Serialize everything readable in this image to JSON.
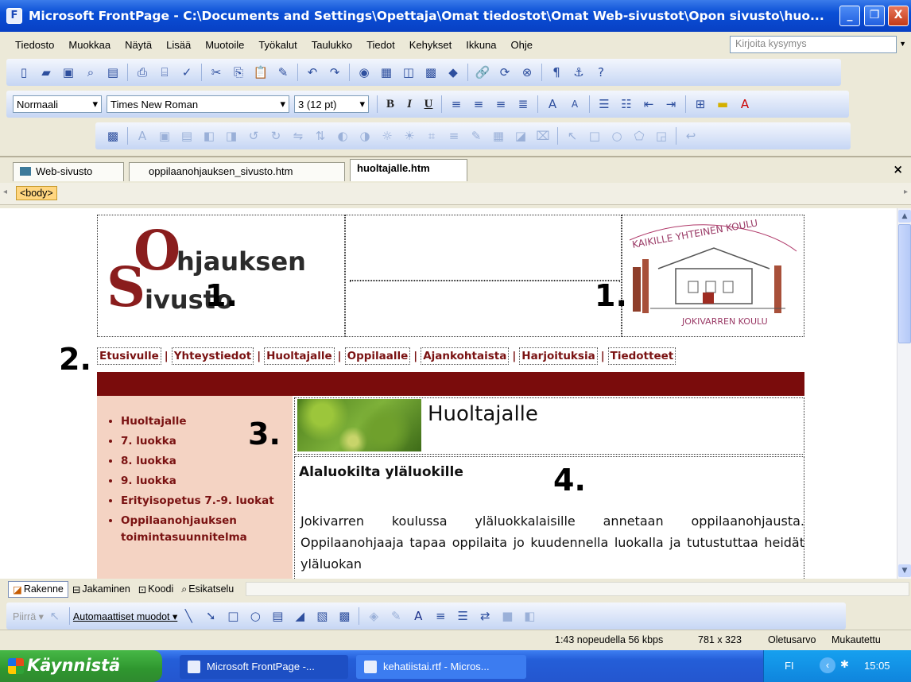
{
  "window": {
    "title": "Microsoft FrontPage - C:\\Documents and Settings\\Opettaja\\Omat tiedostot\\Omat Web-sivustot\\Opon sivusto\\huo...",
    "minimize": "_",
    "maximize": "❐",
    "close": "X"
  },
  "menu": {
    "items": [
      "Tiedosto",
      "Muokkaa",
      "Näytä",
      "Lisää",
      "Muotoile",
      "Työkalut",
      "Taulukko",
      "Tiedot",
      "Kehykset",
      "Ikkuna",
      "Ohje"
    ],
    "ask_placeholder": "Kirjoita kysymys"
  },
  "formatting": {
    "style": "Normaali",
    "font": "Times New Roman",
    "size": "3 (12 pt)",
    "bold": "B",
    "italic": "I",
    "underline": "U"
  },
  "doc_tabs": [
    "Web-sivusto",
    "oppilaanohjauksen_sivusto.htm",
    "huoltajalle.htm"
  ],
  "tab_close": "×",
  "quick_tag": "<body>",
  "page": {
    "logo_o": "O",
    "logo_s": "S",
    "logo_line1": "hjauksen",
    "logo_line2": "ivusto",
    "school_top": "KAIKILLE YHTEINEN KOULU",
    "school_bottom": "JOKIVARREN KOULU",
    "annotations": [
      "1.",
      "1.",
      "2.",
      "3.",
      "4."
    ],
    "nav": [
      "Etusivulle",
      "Yhteystiedot",
      "Huoltajalle",
      "Oppilaalle",
      "Ajankohtaista",
      "Harjoituksia",
      "Tiedotteet"
    ],
    "nav_sep": "|",
    "sidebar": [
      "Huoltajalle",
      "7. luokka",
      "8. luokka",
      "9. luokka",
      "Erityisopetus 7.-9. luokat",
      "Oppilaanohjauksen toimintasuunnitelma"
    ],
    "heading": "Huoltajalle",
    "subheading": "Alaluokilta yläluokille",
    "paragraph": "Jokivarren koulussa yläluokkalaisille annetaan oppilaanohjausta. Oppilaanohjaaja tapaa oppilaita jo kuudennella luokalla ja tutustuttaa heidät yläluokan"
  },
  "view_tabs": [
    "Rakenne",
    "Jakaminen",
    "Koodi",
    "Esikatselu"
  ],
  "drawing": {
    "draw": "Piirrä",
    "autoshapes": "Automaattiset muodot"
  },
  "status": {
    "speed": "1:43 nopeudella 56 kbps",
    "dims": "781 x 323",
    "default": "Oletusarvo",
    "custom": "Mukautettu"
  },
  "taskbar": {
    "start": "Käynnistä",
    "items": [
      "Microsoft FrontPage -...",
      "kehatiistai.rtf - Micros..."
    ],
    "lang": "FI",
    "time": "15:05"
  }
}
